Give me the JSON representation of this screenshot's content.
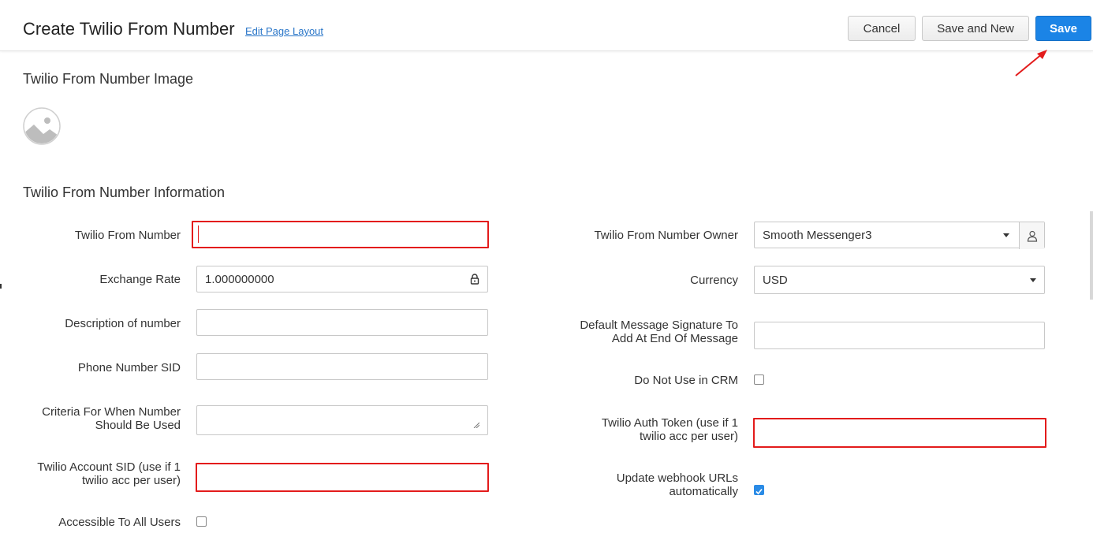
{
  "header": {
    "title": "Create Twilio From Number",
    "edit_link": "Edit Page Layout",
    "buttons": {
      "cancel": "Cancel",
      "save_new": "Save and New",
      "save": "Save"
    }
  },
  "sections": {
    "image": "Twilio From Number Image",
    "info": "Twilio From Number Information"
  },
  "left_fields": {
    "from_number": {
      "label": "Twilio From Number",
      "value": ""
    },
    "exchange_rate": {
      "label": "Exchange Rate",
      "value": "1.000000000"
    },
    "description": {
      "label": "Description of number",
      "value": ""
    },
    "phone_sid": {
      "label": "Phone Number SID",
      "value": ""
    },
    "criteria": {
      "label_line1": "Criteria For When Number",
      "label_line2": "Should Be Used",
      "value": ""
    },
    "account_sid": {
      "label_line1": "Twilio Account SID (use if 1",
      "label_line2": "twilio acc per user)",
      "value": ""
    },
    "accessible": {
      "label": "Accessible To All Users",
      "checked": false
    }
  },
  "right_fields": {
    "owner": {
      "label": "Twilio From Number Owner",
      "value": "Smooth Messenger3"
    },
    "currency": {
      "label": "Currency",
      "value": "USD"
    },
    "signature": {
      "label_line1": "Default Message Signature To",
      "label_line2": "Add At End Of Message",
      "value": ""
    },
    "do_not_use": {
      "label": "Do Not Use in CRM",
      "checked": false
    },
    "auth_token": {
      "label_line1": "Twilio Auth Token (use if 1",
      "label_line2": "twilio acc per user)",
      "value": ""
    },
    "webhook": {
      "label_line1": "Update webhook URLs",
      "label_line2": "automatically",
      "checked": true
    }
  },
  "colors": {
    "accent": "#1b84e6",
    "highlight": "#e31b1b"
  },
  "icons": {
    "lock": "lock-icon",
    "owner": "user-lookup-icon",
    "image": "image-placeholder-icon"
  }
}
